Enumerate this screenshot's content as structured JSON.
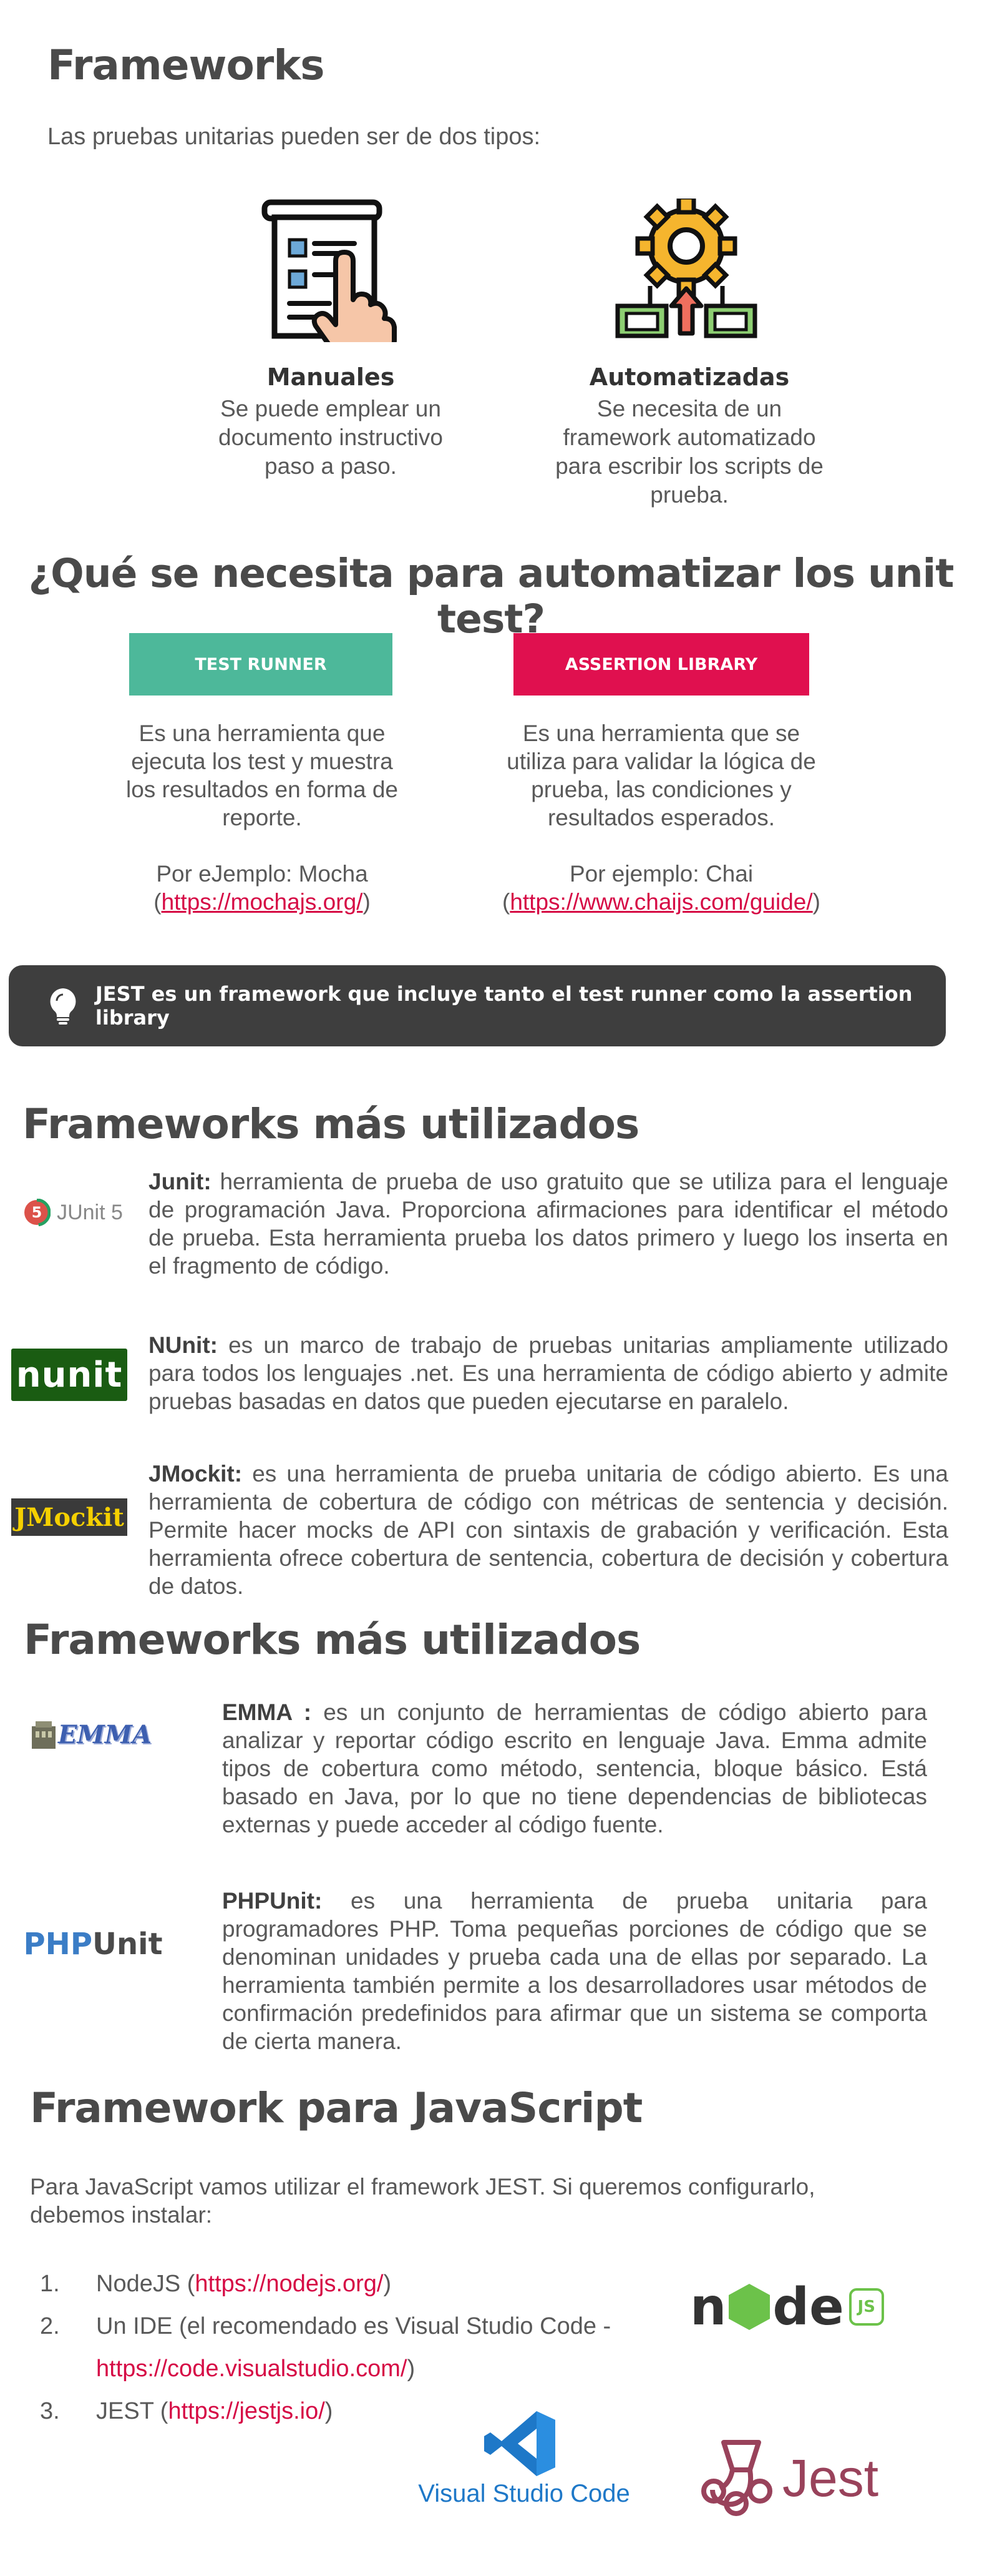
{
  "section1": {
    "title": "Frameworks",
    "intro": "Las pruebas unitarias pueden ser de dos tipos:",
    "manual": {
      "icon": "manual-document-icon",
      "title": "Manuales",
      "desc": "Se puede emplear un documento instructivo paso a paso."
    },
    "auto": {
      "icon": "automation-gear-icon",
      "title": "Automatizadas",
      "desc": "Se necesita de un framework automatizado para escribir los scripts de prueba."
    }
  },
  "section2": {
    "title": "¿Qué se necesita para automatizar los unit test?",
    "runner": {
      "button": "TEST RUNNER",
      "color": "#4db89a",
      "desc": "Es una herramienta que ejecuta los test y muestra los resultados en forma de reporte.",
      "example_prefix": "Por eJemplo: Mocha",
      "example_open": "(",
      "example_link": "https://mochajs.org/",
      "example_close": ")"
    },
    "assertion": {
      "button": "ASSERTION LIBRARY",
      "color": "#e0104f",
      "desc": "Es una herramienta que se utiliza para validar la lógica de prueba, las condiciones y resultados esperados.",
      "example_prefix": "Por ejemplo: Chai",
      "example_open": "(",
      "example_link": "https://www.chaijs.com/guide/",
      "example_close": ")"
    }
  },
  "callout": {
    "icon": "lightbulb-icon",
    "text": "JEST es un framework que incluye tanto el test runner como la assertion library"
  },
  "section3": {
    "title": "Frameworks más utilizados",
    "items": [
      {
        "logo": "junit5-logo",
        "logo_text": "JUnit 5",
        "name": "Junit:",
        "desc": " herramienta de prueba de uso gratuito que se utiliza para el lenguaje de programación Java. Proporciona afirmaciones para identificar el método de prueba. Esta herramienta prueba los datos primero y luego los inserta en el fragmento de código."
      },
      {
        "logo": "nunit-logo",
        "logo_text": "nunit",
        "name": "NUnit:",
        "desc": " es un marco de trabajo de pruebas unitarias ampliamente utilizado para todos los lenguajes .net. Es una herramienta de código abierto y admite pruebas basadas en datos que pueden ejecutarse en paralelo."
      },
      {
        "logo": "jmockit-logo",
        "logo_text": "JMockit",
        "name": "JMockit:",
        "desc": " es una herramienta de prueba unitaria de código abierto. Es una herramienta de cobertura de código con métricas de sentencia y decisión. Permite hacer mocks de API con sintaxis de grabación y verificación. Esta herramienta ofrece cobertura de sentencia, cobertura de decisión y cobertura de datos."
      }
    ]
  },
  "section4": {
    "title": "Frameworks más utilizados",
    "items": [
      {
        "logo": "emma-logo",
        "logo_text": "EMMA",
        "name": "EMMA :",
        "desc": " es un conjunto de herramientas de código abierto para analizar y reportar código escrito en lenguaje Java. Emma admite tipos de cobertura como método, sentencia, bloque básico. Está basado en Java, por lo que no tiene dependencias de bibliotecas externas y puede acceder al código fuente."
      },
      {
        "logo": "phpunit-logo",
        "logo_text_a": "PHP",
        "logo_text_b": "Unit",
        "name": "PHPUnit:",
        "desc": " es una herramienta de prueba unitaria para programadores PHP. Toma pequeñas porciones de código que se denominan unidades y prueba cada una de ellas por separado. La herramienta también permite a los desarrolladores usar métodos de confirmación predefinidos para afirmar que un sistema se comporta de cierta manera."
      }
    ]
  },
  "section5": {
    "title": "Framework para JavaScript",
    "intro": "Para JavaScript vamos utilizar el framework JEST. Si queremos configurarlo, debemos instalar:",
    "steps": [
      {
        "num": "1.",
        "text": "NodeJS (",
        "link": "https://nodejs.org/",
        "close": ")"
      },
      {
        "num": "2.",
        "text": "Un IDE (el recomendado es Visual Studio Code -",
        "link": "https://code.visualstudio.com/",
        "close": ")"
      },
      {
        "num": "3.",
        "text": "JEST (",
        "link": "https://jestjs.io/",
        "close": ")"
      }
    ],
    "node_logo": "nodejs-logo",
    "node_letters": [
      "n",
      "o",
      "d",
      "e"
    ],
    "node_badge": "JS",
    "vscode_logo": "vscode-logo",
    "vscode_text": "Visual Studio Code",
    "jest_logo": "jest-logo",
    "jest_text": "Jest"
  }
}
